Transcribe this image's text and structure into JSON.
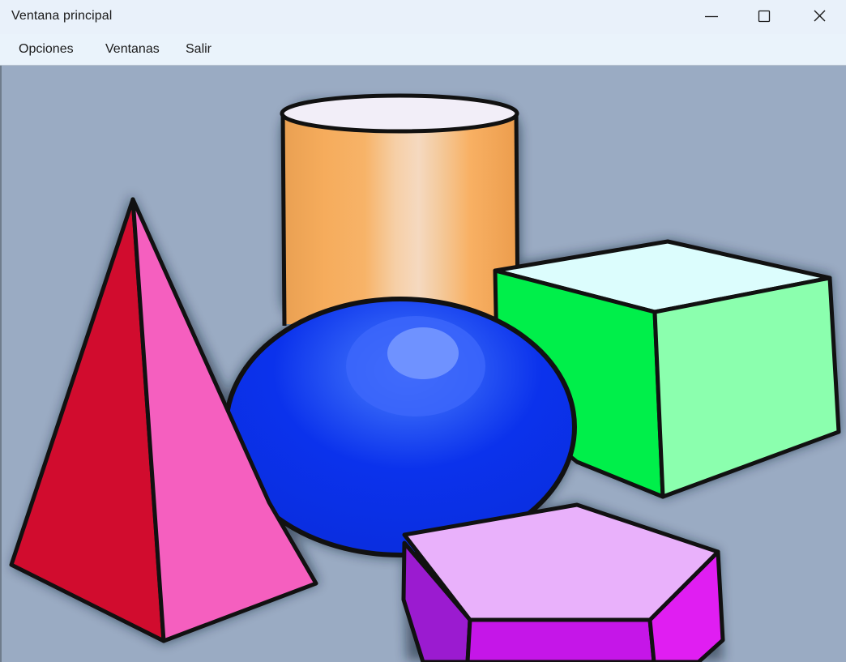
{
  "window": {
    "title": "Ventana principal",
    "controls": {
      "minimize": "minimize-icon",
      "maximize": "maximize-icon",
      "close": "close-icon"
    }
  },
  "menu": {
    "items": [
      "Opciones",
      "Ventanas",
      "Salir"
    ]
  },
  "content": {
    "image_subject": "geometric-shapes-illustration",
    "shapes": [
      "pyramid",
      "cylinder",
      "sphere",
      "cube",
      "hexagonal-prism"
    ],
    "colors": {
      "background": "#9aabc3",
      "pyramid_left": "#d10c2e",
      "pyramid_right": "#f55fbf",
      "cylinder": "#f2a552",
      "sphere": "#0a2fe6",
      "cube_front": "#00f04a",
      "cube_side": "#8bffb0",
      "cube_top": "#dcfdfd",
      "prism_top": "#e9b1fb",
      "prism_side": "#d71ff2"
    }
  }
}
